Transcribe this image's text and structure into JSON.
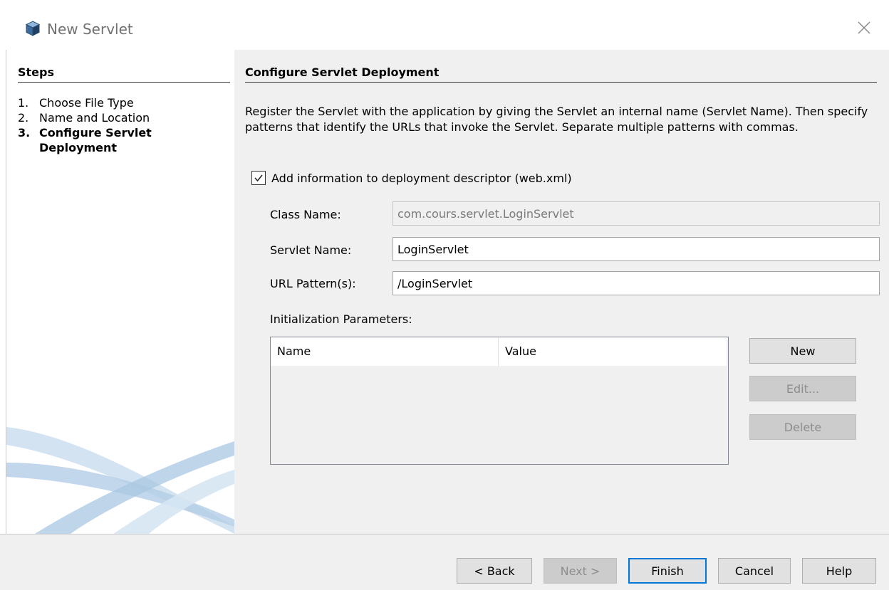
{
  "window": {
    "title": "New Servlet",
    "icon": "cube-icon",
    "close_icon": "close-icon"
  },
  "steps": {
    "heading": "Steps",
    "items": [
      {
        "num": "1.",
        "label": "Choose File Type"
      },
      {
        "num": "2.",
        "label": "Name and Location"
      },
      {
        "num": "3.",
        "label": "Configure Servlet Deployment",
        "current": true
      }
    ]
  },
  "main": {
    "heading": "Configure Servlet Deployment",
    "description": "Register the Servlet with the application by giving the Servlet an internal name (Servlet Name). Then specify patterns that identify the URLs that invoke the Servlet. Separate multiple patterns with commas.",
    "checkbox": {
      "label": "Add information to deployment descriptor (web.xml)",
      "checked": true
    },
    "fields": {
      "class_name": {
        "label": "Class Name:",
        "value": "com.cours.servlet.LoginServlet",
        "readonly": true
      },
      "servlet_name": {
        "label": "Servlet Name:",
        "value": "LoginServlet"
      },
      "url_pattern": {
        "label": "URL Pattern(s):",
        "value": "/LoginServlet"
      }
    },
    "init_params": {
      "label": "Initialization Parameters:",
      "columns": [
        "Name",
        "Value"
      ],
      "rows": []
    },
    "param_buttons": {
      "new": "New",
      "edit": "Edit...",
      "delete": "Delete"
    }
  },
  "footer": {
    "back": "< Back",
    "next": "Next >",
    "finish": "Finish",
    "cancel": "Cancel",
    "help": "Help"
  },
  "colors": {
    "panel_bg": "#f0f0f0",
    "default_button_border": "#0078d7",
    "swoosh": "#a9c7e2"
  }
}
